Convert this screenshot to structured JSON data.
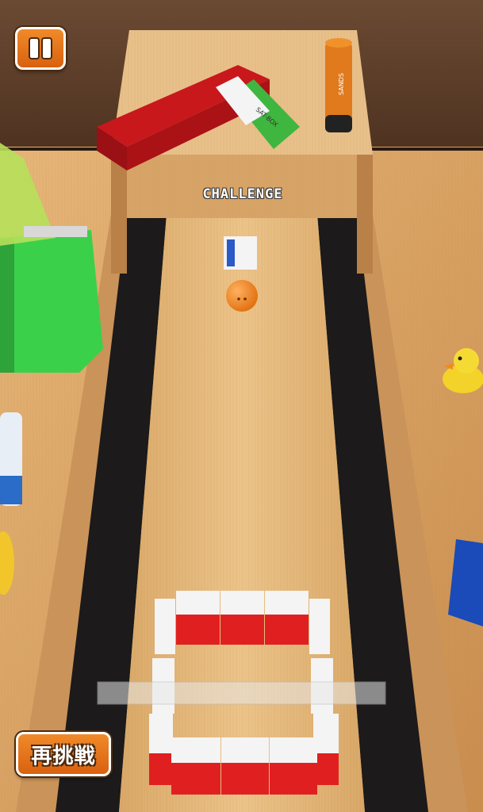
{
  "hud": {
    "pause_icon": "pause-icon",
    "retry_label": "再挑戦"
  },
  "board": {
    "label": "CHALLENGE"
  },
  "brand": {
    "box_label": "SAT-BOX",
    "glue_label": "SANDS"
  },
  "colors": {
    "button_orange": "#e8781d",
    "lane_wood": "#e0b57a",
    "gutter": "#1c1a1a",
    "ball": "#f08a1c",
    "eraser_red": "#e02020"
  }
}
